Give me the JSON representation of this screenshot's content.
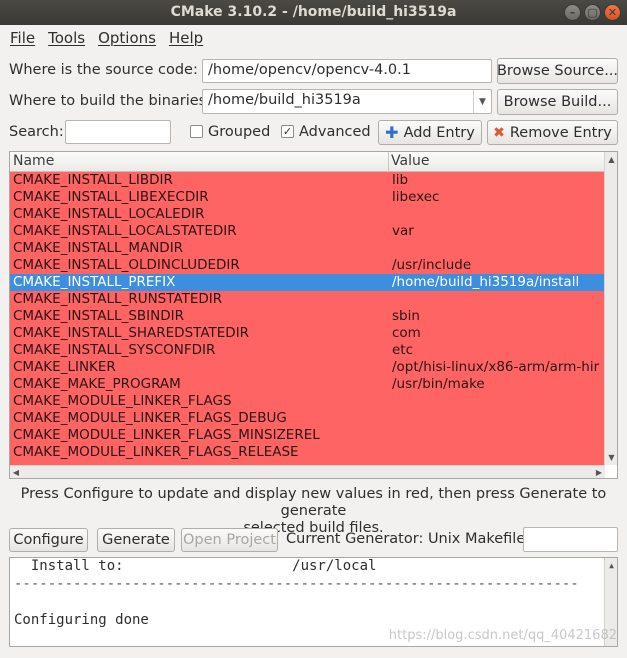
{
  "window": {
    "title": "CMake 3.10.2 - /home/build_hi3519a",
    "controls": [
      "–",
      "▢",
      "✕"
    ]
  },
  "menu": [
    "File",
    "Tools",
    "Options",
    "Help"
  ],
  "source": {
    "label": "Where is the source code:",
    "value": "/home/opencv/opencv-4.0.1",
    "browse_label": "Browse Source..."
  },
  "build": {
    "label": "Where to build the binaries:",
    "value": "/home/build_hi3519a",
    "browse_label": "Browse Build..."
  },
  "search": {
    "label": "Search:",
    "value": "",
    "grouped_label": "Grouped",
    "grouped_checked": false,
    "advanced_label": "Advanced",
    "advanced_checked": true,
    "add_entry_label": "Add Entry",
    "remove_entry_label": "Remove Entry"
  },
  "table": {
    "columns": [
      "Name",
      "Value"
    ],
    "row_color": "#ff6464",
    "selected_color": "#3d8ede",
    "rows": [
      {
        "name": "CMAKE_INSTALL_LIBDIR",
        "value": "lib"
      },
      {
        "name": "CMAKE_INSTALL_LIBEXECDIR",
        "value": "libexec"
      },
      {
        "name": "CMAKE_INSTALL_LOCALEDIR",
        "value": ""
      },
      {
        "name": "CMAKE_INSTALL_LOCALSTATEDIR",
        "value": "var"
      },
      {
        "name": "CMAKE_INSTALL_MANDIR",
        "value": ""
      },
      {
        "name": "CMAKE_INSTALL_OLDINCLUDEDIR",
        "value": "/usr/include"
      },
      {
        "name": "CMAKE_INSTALL_PREFIX",
        "value": "/home/build_hi3519a/install",
        "selected": true
      },
      {
        "name": "CMAKE_INSTALL_RUNSTATEDIR",
        "value": ""
      },
      {
        "name": "CMAKE_INSTALL_SBINDIR",
        "value": "sbin"
      },
      {
        "name": "CMAKE_INSTALL_SHAREDSTATEDIR",
        "value": "com"
      },
      {
        "name": "CMAKE_INSTALL_SYSCONFDIR",
        "value": "etc"
      },
      {
        "name": "CMAKE_LINKER",
        "value": "/opt/hisi-linux/x86-arm/arm-hir"
      },
      {
        "name": "CMAKE_MAKE_PROGRAM",
        "value": "/usr/bin/make"
      },
      {
        "name": "CMAKE_MODULE_LINKER_FLAGS",
        "value": ""
      },
      {
        "name": "CMAKE_MODULE_LINKER_FLAGS_DEBUG",
        "value": ""
      },
      {
        "name": "CMAKE_MODULE_LINKER_FLAGS_MINSIZEREL",
        "value": ""
      },
      {
        "name": "CMAKE_MODULE_LINKER_FLAGS_RELEASE",
        "value": ""
      }
    ]
  },
  "message": {
    "line1": "Press Configure to update and display new values in red, then press Generate to generate",
    "line2": "selected build files."
  },
  "actions": {
    "configure_label": "Configure",
    "generate_label": "Generate",
    "open_project_label": "Open Project",
    "generator_text": "Current Generator: Unix Makefiles"
  },
  "output": {
    "lines": [
      "  Install to:                    /usr/local",
      "-------------------------------------------------------------------",
      "",
      "Configuring done"
    ]
  },
  "watermark": "https://blog.csdn.net/qq_40421682"
}
